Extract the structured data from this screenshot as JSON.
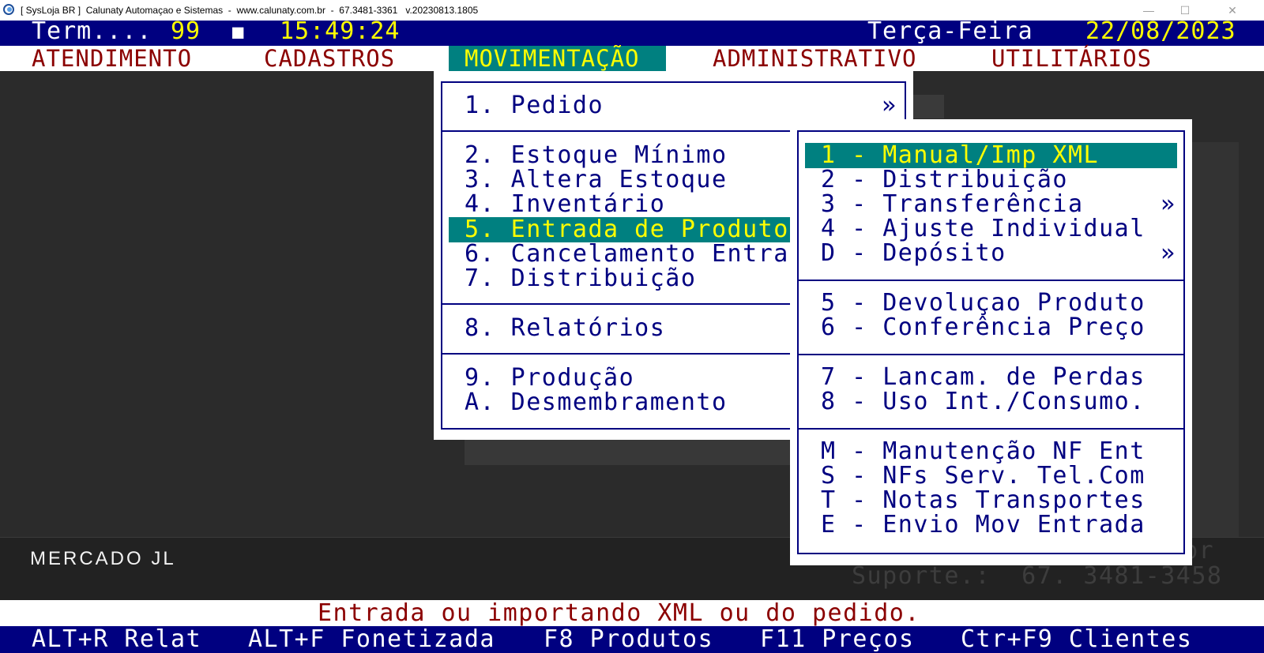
{
  "window": {
    "title": "[ SysLoja BR ]  Calunaty Automaçao e Sistemas  -  www.calunaty.com.br  -  67.3481-3361   v.20230813.1805",
    "minimize": "—",
    "maximize": "☐",
    "close": "✕"
  },
  "status": {
    "term_label": "Term....",
    "term_number": "99",
    "indicator": "■",
    "time": "15:49:24",
    "weekday": "Terça-Feira",
    "date": "22/08/2023"
  },
  "menubar": [
    {
      "label": "ATENDIMENTO"
    },
    {
      "label": "CADASTROS"
    },
    {
      "label": "MOVIMENTAÇÃO"
    },
    {
      "label": "ADMINISTRATIVO"
    },
    {
      "label": "UTILITÁRIOS"
    }
  ],
  "movimentacao_menu": {
    "items": [
      {
        "label": "1. Pedido",
        "submenu_arrow": "»"
      },
      {
        "label": "2. Estoque Mínimo"
      },
      {
        "label": "3. Altera Estoque"
      },
      {
        "label": "4. Inventário"
      },
      {
        "label": "5. Entrada de Produto"
      },
      {
        "label": "6. Cancelamento Entra"
      },
      {
        "label": "7. Distribuição"
      },
      {
        "label": "8. Relatórios"
      },
      {
        "label": "9. Produção"
      },
      {
        "label": "A. Desmembramento"
      }
    ]
  },
  "entrada_submenu": {
    "items": [
      {
        "label": "1 - Manual/Imp XML"
      },
      {
        "label": "2 - Distribuição"
      },
      {
        "label": "3 - Transferência",
        "submenu_arrow": "»"
      },
      {
        "label": "4 - Ajuste Individual"
      },
      {
        "label": "D - Depósito",
        "submenu_arrow": "»"
      },
      {
        "label": "5 - Devoluçao Produto"
      },
      {
        "label": "6 - Conferência Preço"
      },
      {
        "label": "7 - Lancam. de Perdas"
      },
      {
        "label": "8 - Uso Int./Consumo."
      },
      {
        "label": "M - Manutenção NF Ent"
      },
      {
        "label": "S - NFs Serv. Tel.Com"
      },
      {
        "label": "T - Notas Transportes"
      },
      {
        "label": "E - Envio Mov Entrada"
      }
    ]
  },
  "background": {
    "company": "MERCADO JL",
    "ghost_line1": "br",
    "ghost_line2": "Suporte.:  67. 3481-3458"
  },
  "hint": "Entrada ou importando XML ou do pedido.",
  "function_keys": [
    {
      "label": "ALT+R Relat"
    },
    {
      "label": "ALT+F Fonetizada"
    },
    {
      "label": "F8 Produtos"
    },
    {
      "label": "F11 Preços"
    },
    {
      "label": "Ctr+F9 Clientes"
    }
  ],
  "colors": {
    "navy": "#000080",
    "teal_highlight": "#008080",
    "yellow": "#ffff00",
    "darkred": "#8b0000",
    "background": "#2b2b2b"
  }
}
